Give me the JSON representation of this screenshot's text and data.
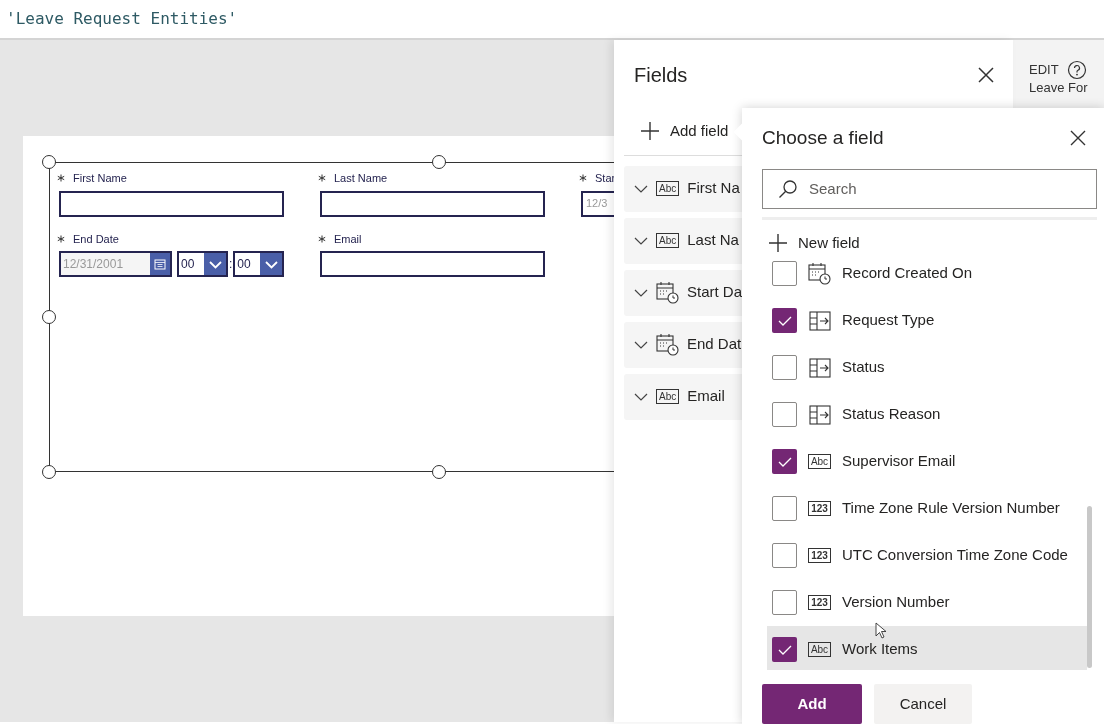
{
  "formula_bar": {
    "text": "'Leave Request Entities'"
  },
  "form": {
    "fields": [
      {
        "label": "First Name",
        "required": true,
        "kind": "text"
      },
      {
        "label": "Last Name",
        "required": true,
        "kind": "text"
      },
      {
        "label": "Star",
        "required": true,
        "kind": "date",
        "value": "12/3"
      },
      {
        "label": "End Date",
        "required": true,
        "kind": "datetime",
        "value": "12/31/2001",
        "hour": "00",
        "separator": ":",
        "minute": "00"
      },
      {
        "label": "Email",
        "required": true,
        "kind": "text"
      }
    ]
  },
  "fields_panel": {
    "title": "Fields",
    "add_label": "Add field",
    "items": [
      {
        "label": "First Na",
        "kind": "text",
        "badge": "Abc"
      },
      {
        "label": "Last Na",
        "kind": "text",
        "badge": "Abc"
      },
      {
        "label": "Start Da",
        "kind": "datetime"
      },
      {
        "label": "End Dat",
        "kind": "datetime"
      },
      {
        "label": "Email",
        "kind": "text",
        "badge": "Abc"
      }
    ]
  },
  "properties_panel": {
    "mode": "EDIT",
    "title": "Leave For"
  },
  "choose_field": {
    "title": "Choose a field",
    "search": {
      "placeholder": "Search"
    },
    "new_field": "New field",
    "items": [
      {
        "label": "Record Created On",
        "kind": "datetime",
        "checked": false,
        "hovered": false
      },
      {
        "label": "Request Type",
        "kind": "choice",
        "checked": true,
        "hovered": false
      },
      {
        "label": "Status",
        "kind": "choice",
        "checked": false,
        "hovered": false
      },
      {
        "label": "Status Reason",
        "kind": "choice",
        "checked": false,
        "hovered": false
      },
      {
        "label": "Supervisor Email",
        "kind": "text",
        "badge": "Abc",
        "checked": true,
        "hovered": false
      },
      {
        "label": "Time Zone Rule Version Number",
        "kind": "number",
        "badge": "123",
        "checked": false,
        "hovered": false
      },
      {
        "label": "UTC Conversion Time Zone Code",
        "kind": "number",
        "badge": "123",
        "checked": false,
        "hovered": false
      },
      {
        "label": "Version Number",
        "kind": "number",
        "badge": "123",
        "checked": false,
        "hovered": false
      },
      {
        "label": "Work Items",
        "kind": "text",
        "badge": "Abc",
        "checked": true,
        "hovered": true
      }
    ],
    "buttons": [
      {
        "label": "Add",
        "kind": "primary"
      },
      {
        "label": "Cancel",
        "kind": "secondary"
      }
    ]
  }
}
